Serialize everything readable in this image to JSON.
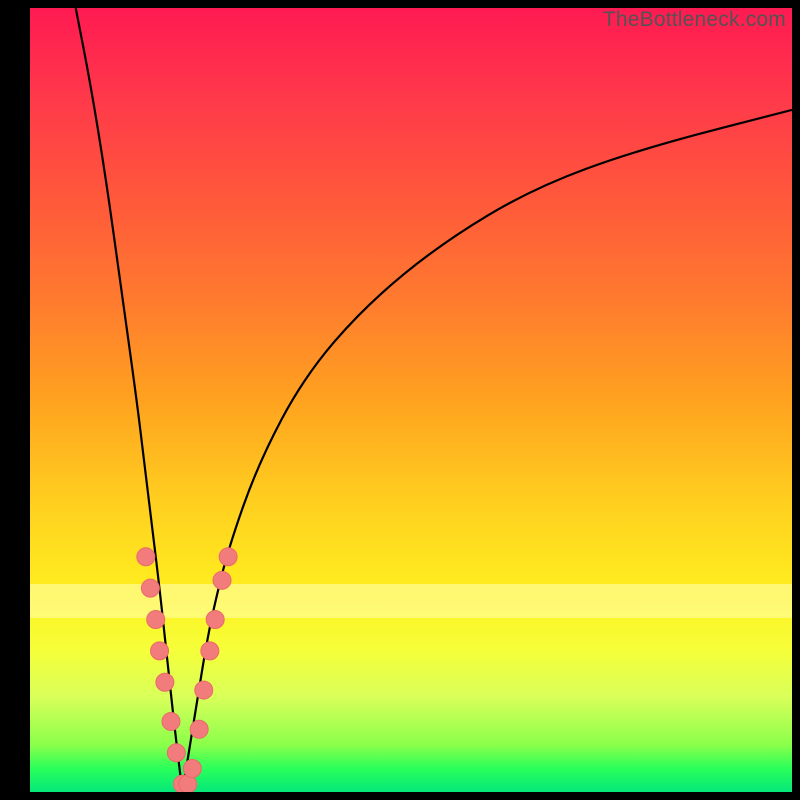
{
  "watermark": "TheBottleneck.com",
  "colors": {
    "frame": "#000000",
    "curve": "#000000",
    "marker_fill": "#f27b7b",
    "marker_stroke": "#e86a6a",
    "gradient": [
      "#ff1a52",
      "#ff3a4a",
      "#ff5a3a",
      "#ff7a2f",
      "#ffa21f",
      "#ffcf1f",
      "#fff01f",
      "#f5ff3a",
      "#d8ff5a",
      "#8aff4a",
      "#2aff5a",
      "#05e87a"
    ]
  },
  "chart_data": {
    "type": "line",
    "title": "",
    "xlabel": "",
    "ylabel": "",
    "xlim": [
      0,
      100
    ],
    "ylim": [
      0,
      100
    ],
    "note": "V-shaped bottleneck curve. y ≈ |x − 20| style cusp near x≈20, left branch steep, right branch shallow asymptote.",
    "series": [
      {
        "name": "left-branch",
        "x": [
          6,
          8,
          10,
          12,
          14,
          15,
          16,
          17,
          18,
          19,
          20
        ],
        "y": [
          100,
          90,
          78,
          64,
          50,
          42,
          34,
          26,
          17,
          8,
          0
        ]
      },
      {
        "name": "right-branch",
        "x": [
          20,
          21,
          22,
          23,
          24,
          26,
          30,
          36,
          44,
          54,
          66,
          80,
          100
        ],
        "y": [
          0,
          6,
          12,
          18,
          23,
          31,
          42,
          53,
          62,
          70,
          77,
          82,
          87
        ]
      }
    ],
    "markers": {
      "name": "highlighted-points",
      "note": "Pink dots clustered near the cusp on both branches, roughly y ∈ [0, 30].",
      "points": [
        {
          "x": 15.2,
          "y": 30
        },
        {
          "x": 15.8,
          "y": 26
        },
        {
          "x": 16.5,
          "y": 22
        },
        {
          "x": 17.0,
          "y": 18
        },
        {
          "x": 17.7,
          "y": 14
        },
        {
          "x": 18.5,
          "y": 9
        },
        {
          "x": 19.2,
          "y": 5
        },
        {
          "x": 20.0,
          "y": 1
        },
        {
          "x": 20.7,
          "y": 1
        },
        {
          "x": 21.3,
          "y": 3
        },
        {
          "x": 22.2,
          "y": 8
        },
        {
          "x": 22.8,
          "y": 13
        },
        {
          "x": 23.6,
          "y": 18
        },
        {
          "x": 24.3,
          "y": 22
        },
        {
          "x": 25.2,
          "y": 27
        },
        {
          "x": 26.0,
          "y": 30
        }
      ]
    }
  }
}
